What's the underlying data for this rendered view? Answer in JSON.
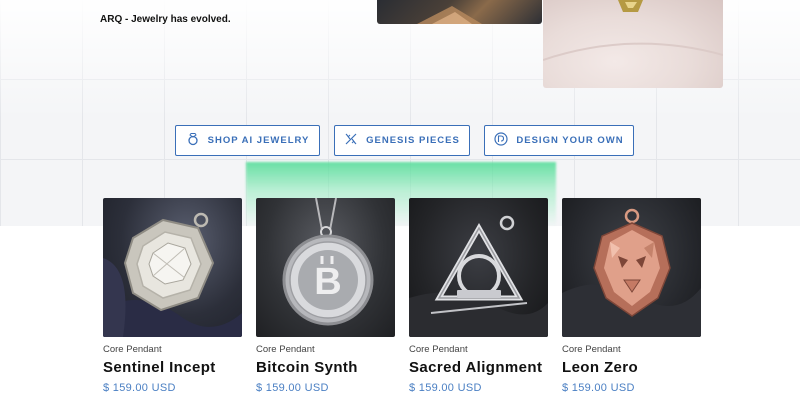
{
  "hero": {
    "tagline": "ARQ - Jewelry has evolved."
  },
  "buttons": [
    {
      "label": "SHOP AI JEWELRY",
      "icon": "ring-icon"
    },
    {
      "label": "GENESIS PIECES",
      "icon": "dna-icon"
    },
    {
      "label": "DESIGN YOUR OWN",
      "icon": "design-badge-icon"
    }
  ],
  "products": [
    {
      "category": "Core Pendant",
      "name": "Sentinel Incept",
      "price": "$ 159.00 USD"
    },
    {
      "category": "Core Pendant",
      "name": "Bitcoin Synth",
      "price": "$ 159.00 USD"
    },
    {
      "category": "Core Pendant",
      "name": "Sacred Alignment",
      "price": "$ 159.00 USD"
    },
    {
      "category": "Core Pendant",
      "name": "Leon Zero",
      "price": "$ 159.00 USD"
    }
  ],
  "colors": {
    "accent": "#3a6fb8",
    "price": "#4a7fc3",
    "glow": "#50dc96"
  }
}
